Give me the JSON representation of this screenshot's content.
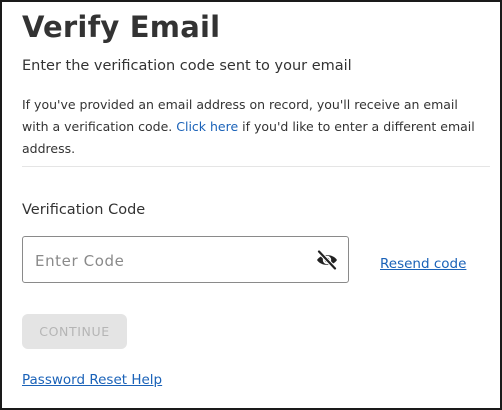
{
  "page": {
    "title": "Verify Email",
    "subtitle": "Enter the verification code sent to your email",
    "description_before": "If you've provided an email address on record, you'll receive an email with a verification code. ",
    "description_link": "Click here",
    "description_after": " if you'd like to enter a different email address."
  },
  "form": {
    "code_label": "Verification Code",
    "code_placeholder": "Enter Code",
    "code_value": "",
    "visibility_icon": "eye-slash-icon",
    "resend_label": "Resend code",
    "continue_label": "CONTINUE",
    "help_link": "Password Reset Help"
  },
  "colors": {
    "link": "#1a62b8",
    "text": "#333333",
    "button_disabled_bg": "#e4e4e4",
    "button_disabled_text": "#b5b5b5"
  }
}
